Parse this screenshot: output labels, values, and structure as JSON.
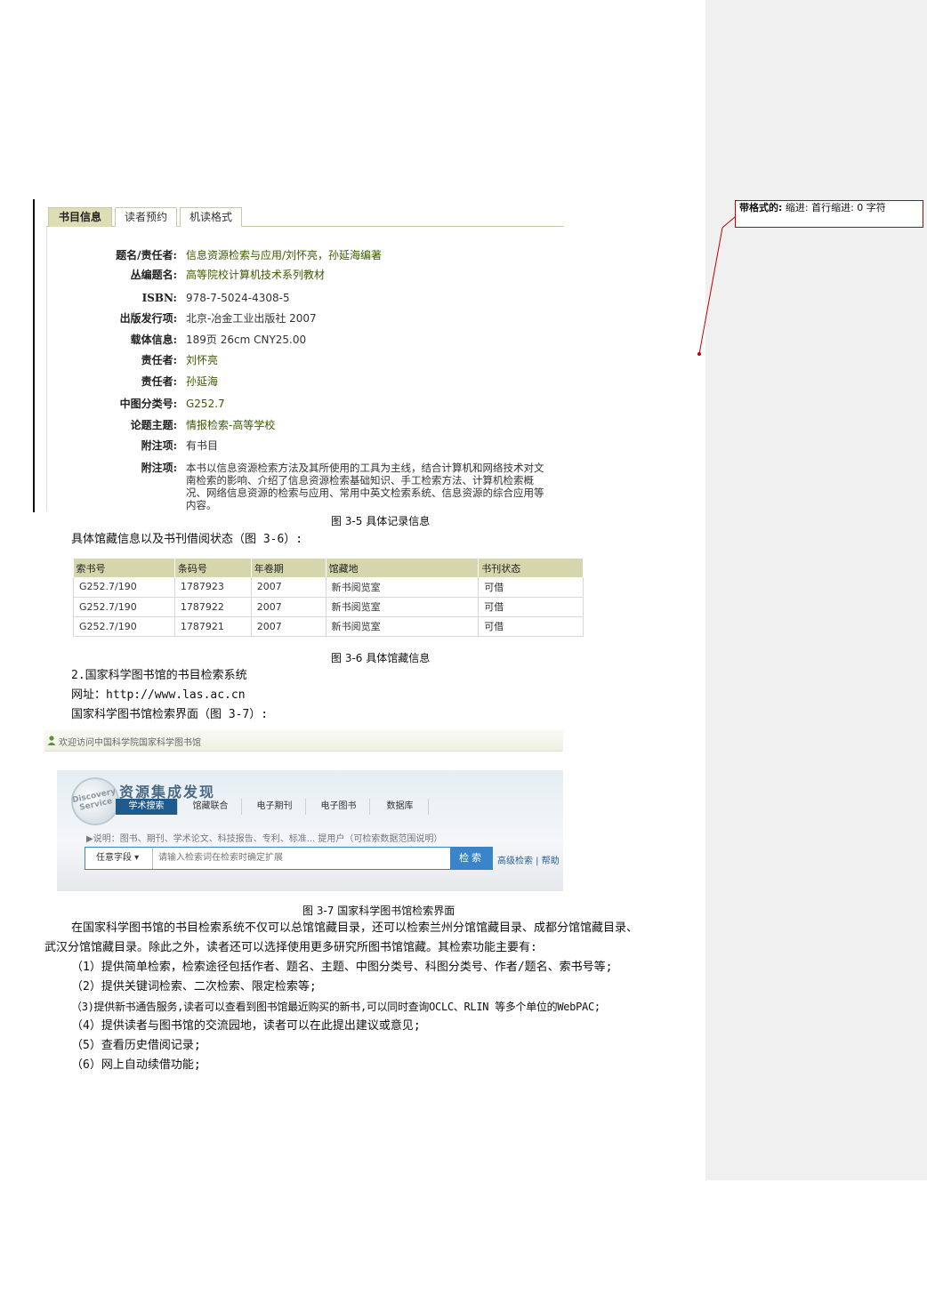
{
  "comment": {
    "label": "带格式的:",
    "text": "缩进: 首行缩进: 0 字符"
  },
  "record": {
    "tabs": [
      "书目信息",
      "读者预约",
      "机读格式"
    ],
    "rows": [
      {
        "label": "题名/责任者:",
        "value": "信息资源检索与应用/刘怀亮，孙延海编著"
      },
      {
        "label": "丛编题名:",
        "value": "高等院校计算机技术系列教材"
      },
      {
        "label": "ISBN:",
        "value": "978-7-5024-4308-5"
      },
      {
        "label": "出版发行项:",
        "value": "北京-冶金工业出版社  2007"
      },
      {
        "label": "载体信息:",
        "value": "189页  26cm CNY25.00"
      },
      {
        "label": "责任者:",
        "value": "刘怀亮"
      },
      {
        "label": "责任者:",
        "value": "孙延海"
      },
      {
        "label": "中图分类号:",
        "value": "G252.7"
      },
      {
        "label": "论题主题:",
        "value": "情报检索-高等学校"
      },
      {
        "label": "附注项:",
        "value": "有书目"
      },
      {
        "label": "附注项:",
        "value_lines": [
          "本书以信息资源检索方法及其所使用的工具为主线，结合计算机和网络技术对文",
          "南检索的影响、介绍了信息资源检索基础知识、手工检索方法、计算机检索概",
          "况、网络信息资源的检索与应用、常用中英文检索系统、信息资源的综合应用等",
          "内容。"
        ]
      }
    ],
    "caption": "图 3-5 具体记录信息"
  },
  "text": {
    "intro_holdings": "具体馆藏信息以及书刊借阅状态（图 3-6）:",
    "section_title": "2.国家科学图书馆的书目检索系统",
    "url_line": "网址：http://www.las.ac.cn",
    "interface_line": "国家科学图书馆检索界面（图 3-7）:",
    "body_line1": "在国家科学图书馆的书目检索系统不仅可以总馆馆藏目录，还可以检索兰州分馆馆藏目录、成都分馆馆藏目录、",
    "body_line2": "武汉分馆馆藏目录。除此之外，读者还可以选择使用更多研究所图书馆馆藏。其检索功能主要有:",
    "items": [
      "（1）提供简单检索，检索途径包括作者、题名、主题、中图分类号、科图分类号、作者/题名、索书号等;",
      "（2）提供关键词检索、二次检索、限定检索等;",
      "（3)提供新书通告服务,读者可以查看到图书馆最近购买的新书,可以同时查询OCLC、RLIN 等多个单位的WebPAC;",
      "（4）提供读者与图书馆的交流园地，读者可以在此提出建议或意见;",
      "（5）查看历史借阅记录;",
      "（6）网上自动续借功能;"
    ]
  },
  "holdings": {
    "headers": [
      "索书号",
      "条码号",
      "年卷期",
      "馆藏地",
      "书刊状态"
    ],
    "rows": [
      [
        "G252.7/190",
        "1787923",
        "2007",
        "新书阅览室",
        "可借"
      ],
      [
        "G252.7/190",
        "1787922",
        "2007",
        "新书阅览室",
        "可借"
      ],
      [
        "G252.7/190",
        "1787921",
        "2007",
        "新书阅览室",
        "可借"
      ]
    ],
    "caption": "图 3-6 具体馆藏信息"
  },
  "las": {
    "welcome": "欢迎访问中国科学院国家科学图书馆",
    "logo_text": "Discovery Service",
    "title": "资源集成发现",
    "nav": [
      "学术搜索",
      "馆藏联合",
      "电子期刊",
      "电子图书",
      "数据库"
    ],
    "hint": "▶说明：图书、期刊、学术论文、科技报告、专利、标准...  提用户（可检索数据范围说明）",
    "field_select": "任意字段 ▾",
    "search_placeholder": "请输入检索词在检索时确定扩展",
    "search_button": "检索",
    "links": "高级检索 | 帮助",
    "caption": "图 3-7 国家科学图书馆检索界面"
  }
}
